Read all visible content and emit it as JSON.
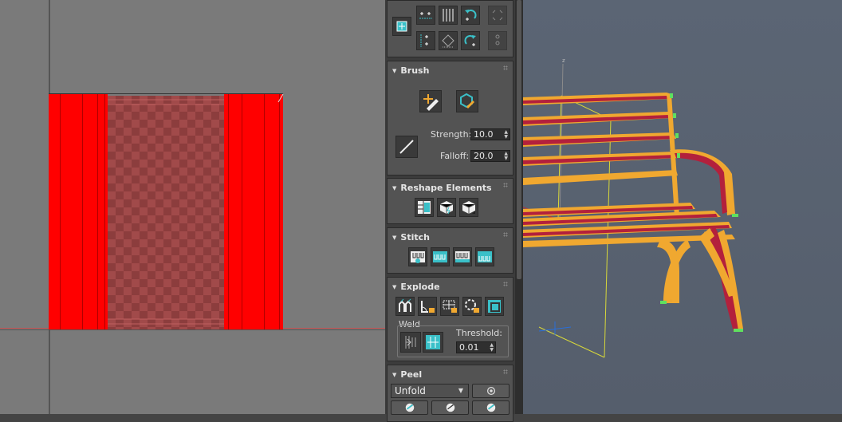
{
  "panel": {
    "brush": {
      "title": "Brush",
      "strength_label": "Strength:",
      "strength_value": "10.0",
      "falloff_label": "Falloff:",
      "falloff_value": "20.0",
      "icons": [
        "move-brush-icon",
        "relax-brush-icon",
        "falloff-curve-icon"
      ]
    },
    "reshape": {
      "title": "Reshape Elements",
      "icons": [
        "straighten-icon",
        "relax-icon",
        "relax-settings-icon"
      ]
    },
    "stitch": {
      "title": "Stitch",
      "icons": [
        "stitch-custom-icon",
        "stitch-target-icon",
        "stitch-average-icon",
        "stitch-source-icon"
      ]
    },
    "explode": {
      "title": "Explode",
      "icons": [
        "break-icon",
        "flatten-by-angle-icon",
        "flatten-by-polygon-icon",
        "flatten-by-smoothing-icon",
        "flatten-by-material-icon"
      ],
      "weld_label": "Weld",
      "weld_icons": [
        "weld-selected-icon",
        "target-weld-icon"
      ],
      "threshold_label": "Threshold:",
      "threshold_value": "0.01"
    },
    "peel": {
      "title": "Peel",
      "mode_value": "Unfold",
      "settings_icon": "gear-icon",
      "icons": [
        "quick-peel-icon",
        "peel-mode-icon",
        "pins-icon"
      ]
    }
  },
  "colors": {
    "seam_red": "#ff0000",
    "bench_slat": "#b3203c",
    "bench_frame": "#f0a830",
    "selection_yellow": "#d8d83a",
    "accent_teal": "#3ac0c8"
  }
}
